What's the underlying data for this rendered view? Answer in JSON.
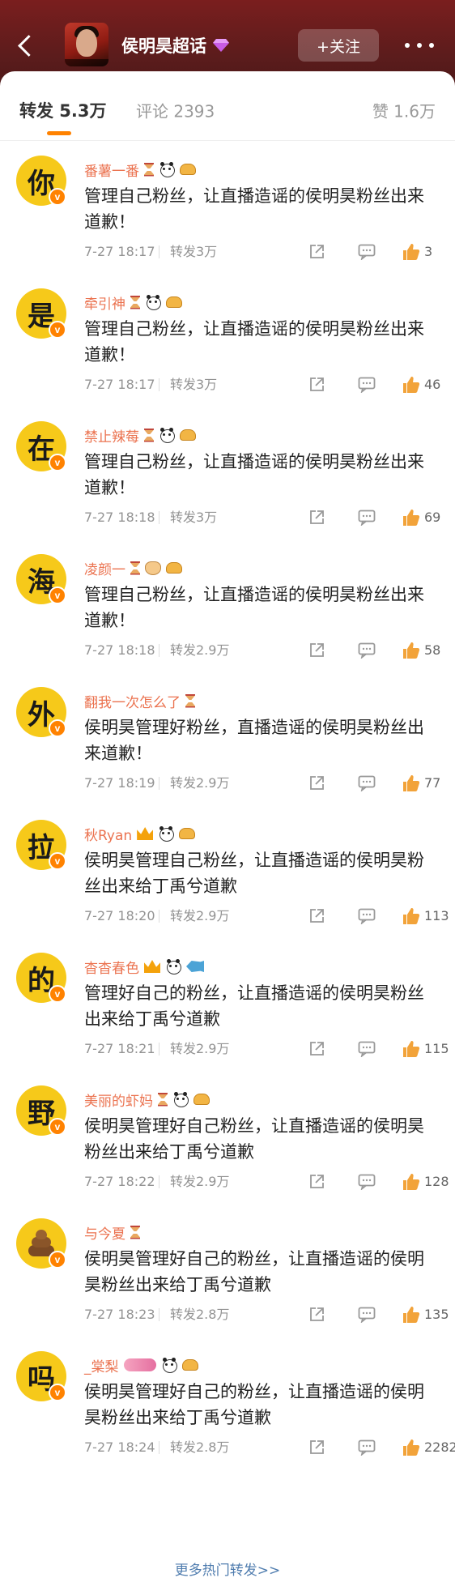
{
  "header": {
    "title": "侯明昊超话",
    "follow_label": "+关注"
  },
  "tabs": {
    "reposts": "转发 5.3万",
    "comments": "评论 2393",
    "likes": "赞 1.6万"
  },
  "items": [
    {
      "avatar_char": "你",
      "username": "番薯一番",
      "content": "管理自己粉丝，让直播造谣的侯明昊粉丝出来道歉！",
      "time": "7-27 18:17",
      "reposts": "转发3万",
      "likes": "3"
    },
    {
      "avatar_char": "是",
      "username": "牵引神",
      "content": "管理自己粉丝，让直播造谣的侯明昊粉丝出来道歉！",
      "time": "7-27 18:17",
      "reposts": "转发3万",
      "likes": "46"
    },
    {
      "avatar_char": "在",
      "username": "禁止辣莓",
      "content": "管理自己粉丝，让直播造谣的侯明昊粉丝出来道歉！",
      "time": "7-27 18:18",
      "reposts": "转发3万",
      "likes": "69"
    },
    {
      "avatar_char": "海",
      "username": "凌颜一",
      "content": "管理自己粉丝，让直播造谣的侯明昊粉丝出来道歉！",
      "time": "7-27 18:18",
      "reposts": "转发2.9万",
      "likes": "58"
    },
    {
      "avatar_char": "外",
      "username": "翻我一次怎么了",
      "content": "侯明昊管理好粉丝，直播造谣的侯明昊粉丝出来道歉！",
      "time": "7-27 18:19",
      "reposts": "转发2.9万",
      "likes": "77"
    },
    {
      "avatar_char": "拉",
      "username": "秋Ryan",
      "content": "侯明昊管理自己粉丝，让直播造谣的侯明昊粉丝出来给丁禹兮道歉",
      "time": "7-27 18:20",
      "reposts": "转发2.9万",
      "likes": "113"
    },
    {
      "avatar_char": "的",
      "username": "杳杳春色",
      "content": "管理好自己的粉丝，让直播造谣的侯明昊粉丝出来给丁禹兮道歉",
      "time": "7-27 18:21",
      "reposts": "转发2.9万",
      "likes": "115"
    },
    {
      "avatar_char": "野",
      "username": "美丽的虾妈",
      "content": "侯明昊管理好自己粉丝，让直播造谣的侯明昊粉丝出来给丁禹兮道歉",
      "time": "7-27 18:22",
      "reposts": "转发2.9万",
      "likes": "128"
    },
    {
      "avatar_char": "",
      "username": "与今夏",
      "content": "侯明昊管理好自己的粉丝，让直播造谣的侯明昊粉丝出来给丁禹兮道歉",
      "time": "7-27 18:23",
      "reposts": "转发2.8万",
      "likes": "135"
    },
    {
      "avatar_char": "吗",
      "username": "_棠梨",
      "content": "侯明昊管理好自己的粉丝，让直播造谣的侯明昊粉丝出来给丁禹兮道歉",
      "time": "7-27 18:24",
      "reposts": "转发2.8万",
      "likes": "2282"
    }
  ],
  "more_link": "更多热门转发>>",
  "colors": {
    "accent": "#ff8200",
    "username": "#eb7350",
    "avatar_bg": "#f6c91a",
    "link": "#507daf"
  }
}
